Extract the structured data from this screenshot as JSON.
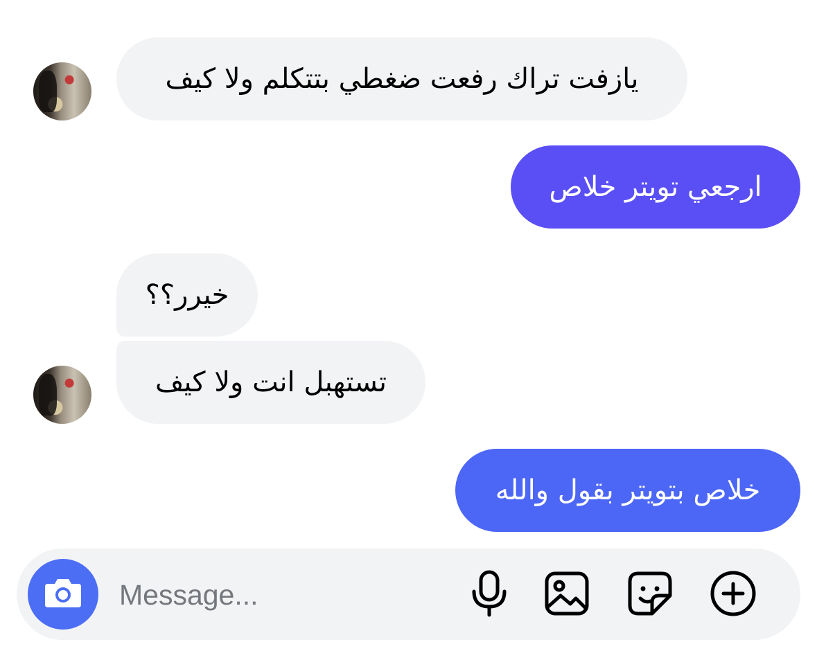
{
  "messages": [
    {
      "text": "يازفت تراك رفعت ضغطي بتتكلم ولا كيف",
      "direction": "incoming"
    },
    {
      "text": "ارجعي تويتر خلاص",
      "direction": "outgoing"
    },
    {
      "text": "خيرر؟؟",
      "direction": "incoming"
    },
    {
      "text": "تستهبل انت ولا كيف",
      "direction": "incoming"
    },
    {
      "text": "خلاص بتويتر بقول والله",
      "direction": "outgoing"
    }
  ],
  "composer": {
    "placeholder": "Message...",
    "value": "",
    "icons": [
      "camera-icon",
      "microphone-icon",
      "image-icon",
      "sticker-icon",
      "plus-icon"
    ]
  },
  "colors": {
    "incoming_bubble": "#f2f3f5",
    "outgoing_bubble_1": "#5a4ff5",
    "outgoing_bubble_2": "#4c66f5",
    "camera_button": "#4c6ef5",
    "composer_bg": "#f2f3f5"
  }
}
